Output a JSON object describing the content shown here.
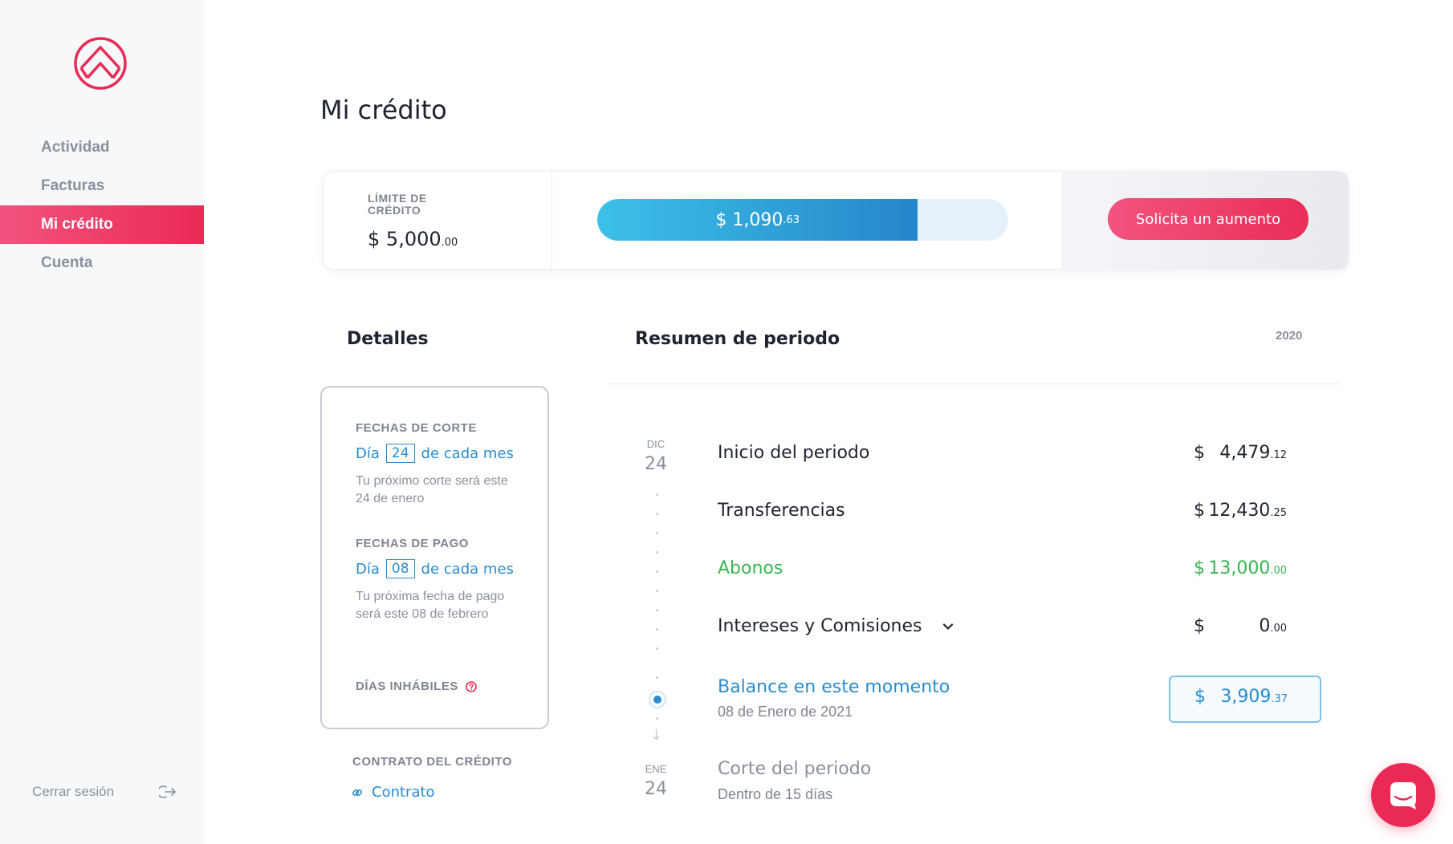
{
  "sidebar": {
    "logo": "app-logo",
    "items": [
      {
        "label": "Actividad"
      },
      {
        "label": "Facturas"
      },
      {
        "label": "Mi crédito"
      },
      {
        "label": "Cuenta"
      }
    ],
    "active_index": 2,
    "logout_label": "Cerrar sesión"
  },
  "page": {
    "title": "Mi crédito"
  },
  "credit": {
    "limit_label": "LÍMITE DE CRÉDITO",
    "limit_symbol": "$",
    "limit_amount": "5,000",
    "limit_cents": ".00",
    "used_symbol": "$",
    "used_amount": "1,090",
    "used_cents": ".63",
    "used_fraction": 0.78,
    "increase_label": "Solicita un aumento"
  },
  "details": {
    "title": "Detalles",
    "cut_label": "FECHAS DE CORTE",
    "cut_day_prefix": "Día",
    "cut_day": "24",
    "cut_day_suffix": "de cada mes",
    "cut_note": "Tu próximo corte será este 24 de enero",
    "pay_label": "FECHAS DE PAGO",
    "pay_day_prefix": "Día",
    "pay_day": "08",
    "pay_day_suffix": "de cada mes",
    "pay_note": "Tu próxima fecha de pago será este 08 de febrero",
    "non_working_label": "DÍAS INHÁBILES",
    "contract_label": "CONTRATO DEL CRÉDITO",
    "contract_link": "Contrato"
  },
  "summary": {
    "title": "Resumen de periodo",
    "year": "2020",
    "start_month": "DIC",
    "start_day": "24",
    "end_month": "ENE",
    "end_day": "24",
    "rows": [
      {
        "label": "Inicio del periodo",
        "symbol": "$",
        "amount": "4,479",
        "cents": ".12"
      },
      {
        "label": "Transferencias",
        "symbol": "$",
        "amount": "12,430",
        "cents": ".25"
      },
      {
        "label": "Abonos",
        "symbol": "$",
        "amount": "13,000",
        "cents": ".00"
      },
      {
        "label": "Intereses y Comisiones",
        "symbol": "$",
        "amount": "0",
        "cents": ".00"
      }
    ],
    "balance_label": "Balance en este momento",
    "balance_date": "08 de Enero de 2021",
    "balance_symbol": "$",
    "balance_amount": "3,909",
    "balance_cents": ".37",
    "cut_label": "Corte del periodo",
    "cut_sub": "Dentro de 15 días"
  },
  "colors": {
    "brand": "#ea2a55",
    "accent_blue": "#2a8ccf",
    "green": "#38b553"
  },
  "icons": [
    "app-logo",
    "logout-icon",
    "chevron-down-icon",
    "help-circle-icon",
    "link-icon",
    "chat-icon"
  ]
}
